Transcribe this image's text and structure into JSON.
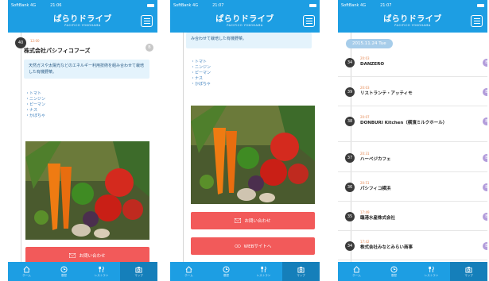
{
  "status_bar": {
    "carrier": "SoftBank 4G",
    "times": [
      "21:06",
      "21:07",
      "21:07"
    ]
  },
  "app": {
    "logo_text": "ぱらりドライブ",
    "logo_sub": "PACIFICO YOKOHAMA"
  },
  "tabbar": {
    "tabs": [
      {
        "label": "ホーム",
        "icon": "home-icon"
      },
      {
        "label": "履歴",
        "icon": "clock-icon"
      },
      {
        "label": "レストラン",
        "icon": "fork-knife-icon"
      },
      {
        "label": "マップ",
        "icon": "camera-icon"
      }
    ]
  },
  "screen1": {
    "badge": "40",
    "time": "12:00",
    "shop_name": "株式会社パシフィコフーズ",
    "side_button": "B",
    "description": "天然ガスや太陽光などのエネルギー利用技術を組み合わせて栽培した有機野菜。",
    "vegetables": [
      "・トマト",
      "・ニンジン",
      "・ピーマン",
      "・ナス",
      "・かぼちゃ"
    ],
    "contact_button": "お問い合わせ"
  },
  "screen2": {
    "description_tail": "み合わせて栽培した有機野菜。",
    "vegetables": [
      "・トマト",
      "・ニンジン",
      "・ピーマン",
      "・ナス",
      "・かぼちゃ"
    ],
    "contact_button": "お問い合わせ",
    "web_button": "WEBサイトへ"
  },
  "screen3": {
    "date": "2015.11.24 Tue",
    "items": [
      {
        "num": "34",
        "time": "20:03",
        "name": "DANZERO"
      },
      {
        "num": "39",
        "time": "20:03",
        "name": "リストランテ・アッティモ"
      },
      {
        "num": "38",
        "time": "20:07",
        "name": "DONBURI Kitchen（横濱ミルクホール）"
      },
      {
        "num": "37",
        "time": "20:31",
        "name": "ハーベジカフェ"
      },
      {
        "num": "36",
        "time": "20:51",
        "name": "パシフィコ横浜"
      },
      {
        "num": "35",
        "time": "17:49",
        "name": "臨港水産株式会社"
      },
      {
        "num": "34",
        "time": "17:42",
        "name": "株式会社みなとみらい商事"
      }
    ],
    "side_label": "B"
  }
}
